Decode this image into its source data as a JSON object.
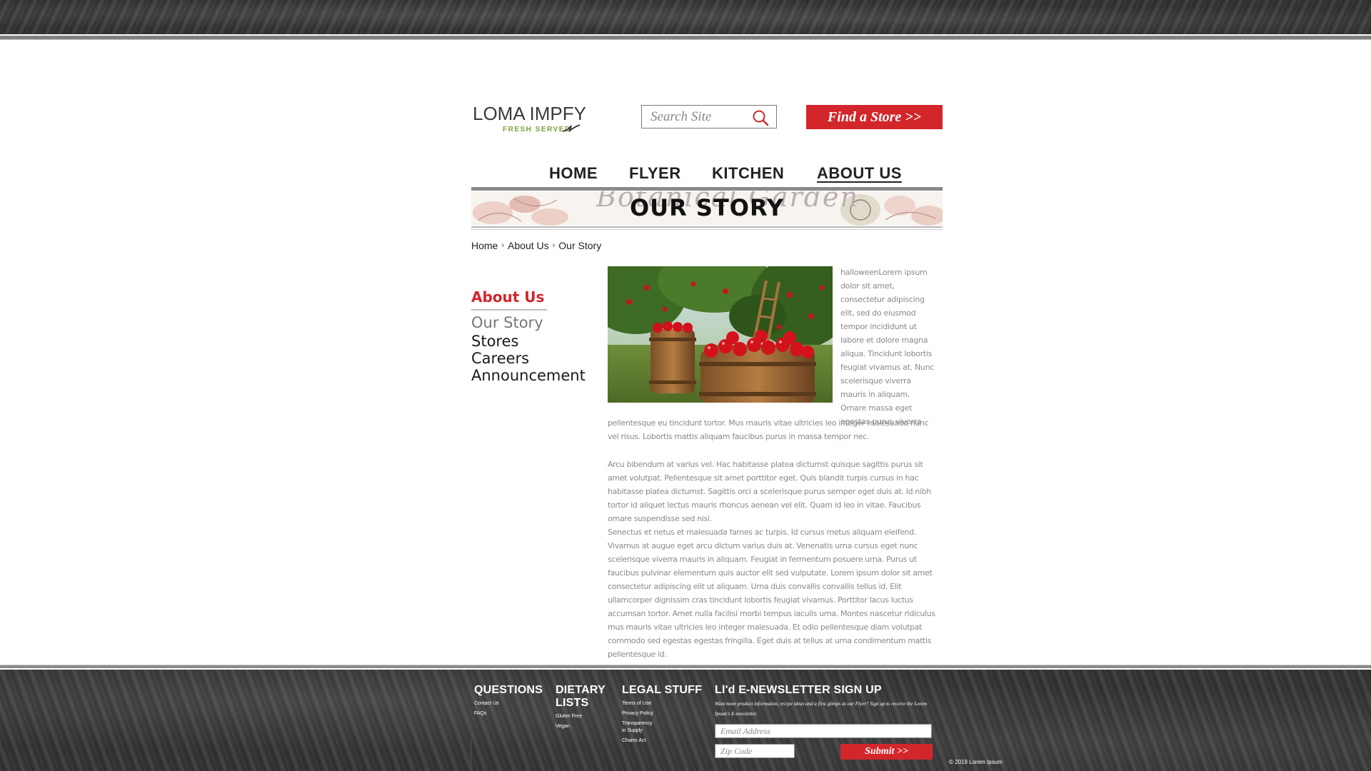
{
  "header": {
    "logo_main": "LOMA IMPFY",
    "logo_sub": "FRESH  SERVED",
    "search_placeholder": "Search Site",
    "find_store_label": "Find a Store >>"
  },
  "nav": {
    "items": [
      {
        "label": "HOME"
      },
      {
        "label": "FLYER"
      },
      {
        "label": "KITCHEN"
      },
      {
        "label": "ABOUT US",
        "active": true
      }
    ]
  },
  "banner": {
    "title": "OUR STORY",
    "ghost_text": "Botanical Garden"
  },
  "breadcrumb": {
    "items": [
      "Home",
      "About Us",
      "Our Story"
    ]
  },
  "sidebar": {
    "title": "About Us",
    "items": [
      {
        "label": "Our Story",
        "current": true
      },
      {
        "label": "Stores"
      },
      {
        "label": "Careers"
      },
      {
        "label": "Announcement"
      }
    ]
  },
  "content": {
    "intro": "halloweenLorem ipsum dolor sit amet, consectetur adipiscing elit, sed do eiusmod tempor incididunt ut labore et dolore magna aliqua. Tincidunt lobortis feugiat vivamus at. Nunc scelerisque viverra mauris in aliquam. Ornare massa eget egestas purus viverra",
    "para1": "pellentesque eu tincidunt tortor. Mus mauris vitae ultricies leo integer malesuada nunc vel risus. Lobortis mattis aliquam faucibus purus in massa tempor nec.",
    "para2": "Arcu bibendum at varius vel. Hac habitasse platea dictumst quisque sagittis purus sit amet volutpat. Pellentesque sit amet porttitor eget. Quis blandit turpis cursus in hac habitasse platea dictumst. Sagittis orci a scelerisque purus semper eget duis at. Id nibh tortor id aliquet lectus mauris rhoncus aenean vel elit. Quam id leo in vitae. Faucibus ornare suspendisse sed nisi.",
    "para3": "Senectus et netus et malesuada fames ac turpis. Id cursus metus aliquam eleifend. Vivamus at augue eget arcu dictum varius duis at. Venenatis urna cursus eget nunc scelerisque viverra mauris in aliquam. Feugiat in fermentum posuere urna. Purus ut faucibus pulvinar elementum quis auctor elit sed vulputate. Lorem ipsum dolor sit amet consectetur adipiscing elit ut aliquam. Urna duis convallis convallis tellus id. Elit ullamcorper dignissim cras tincidunt lobortis feugiat vivamus. Porttitor lacus luctus accumsan tortor. Amet nulla facilisi morbi tempus iaculis urna. Montes nascetur ridiculus mus mauris vitae ultricies leo integer malesuada. Et odio pellentesque diam volutpat commodo sed egestas egestas fringilla. Eget duis at tellus at urna condimentum mattis pellentesque id."
  },
  "footer": {
    "questions": {
      "title": "QUESTIONS",
      "links": [
        "Contact Us",
        "FAQs"
      ]
    },
    "dietary": {
      "title_line1": "DIETARY",
      "title_line2": "LISTS",
      "links": [
        "Gluten Free",
        "Vegan"
      ]
    },
    "legal": {
      "title": "LEGAL STUFF",
      "links": [
        "Terms of Use",
        "Privacy Policy",
        "Transparency",
        "in Supply",
        "Chains Act"
      ]
    },
    "newsletter": {
      "title": "Ll'd E-NEWSLETTER SIGN UP",
      "description": "Want more product information, recipe ideas and a first glimps at our Flyer? Sign up to receive the Lorem Ipsum's E-newsletter.",
      "email_placeholder": "Email Address",
      "zip_placeholder": "Zip Code",
      "submit_label": "Submit >>"
    },
    "copyright": "© 2019 Lorem Ipsum"
  },
  "colors": {
    "accent_red": "#d2262b",
    "logo_green": "#7aa23a",
    "body_gray": "#8a8a8a"
  }
}
